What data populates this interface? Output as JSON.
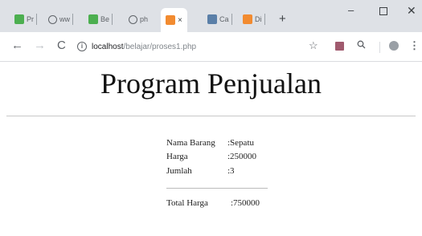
{
  "tabs": [
    {
      "label": "Pr",
      "fav_color": "#4caf50"
    },
    {
      "label": "ww",
      "fav_color": "#5f6368"
    },
    {
      "label": "Be",
      "fav_color": "#4caf50"
    },
    {
      "label": "ph",
      "fav_color": "#ffffff"
    },
    {
      "label": "",
      "fav_color": "#f28b30"
    },
    {
      "label": "Ca",
      "fav_color": "#5a7fa8"
    },
    {
      "label": "Di",
      "fav_color": "#f28b30"
    }
  ],
  "active_tab": {
    "close_label": "×"
  },
  "new_tab_label": "+",
  "window_controls": {
    "minimize": "–",
    "close": "✕"
  },
  "toolbar": {
    "back": "←",
    "forward": "→",
    "reload": "C",
    "url_host": "localhost",
    "url_path": "/belajar/proses1.php",
    "star": "☆",
    "zoom": "🔍",
    "menu": "⋮"
  },
  "page": {
    "title": "Program Penjualan",
    "rows": [
      {
        "label": "Nama Barang",
        "value": ":Sepatu"
      },
      {
        "label": "Harga",
        "value": ":250000"
      },
      {
        "label": "Jumlah",
        "value": ":3"
      }
    ],
    "total": {
      "label": "Total Harga",
      "value": ":750000"
    }
  }
}
